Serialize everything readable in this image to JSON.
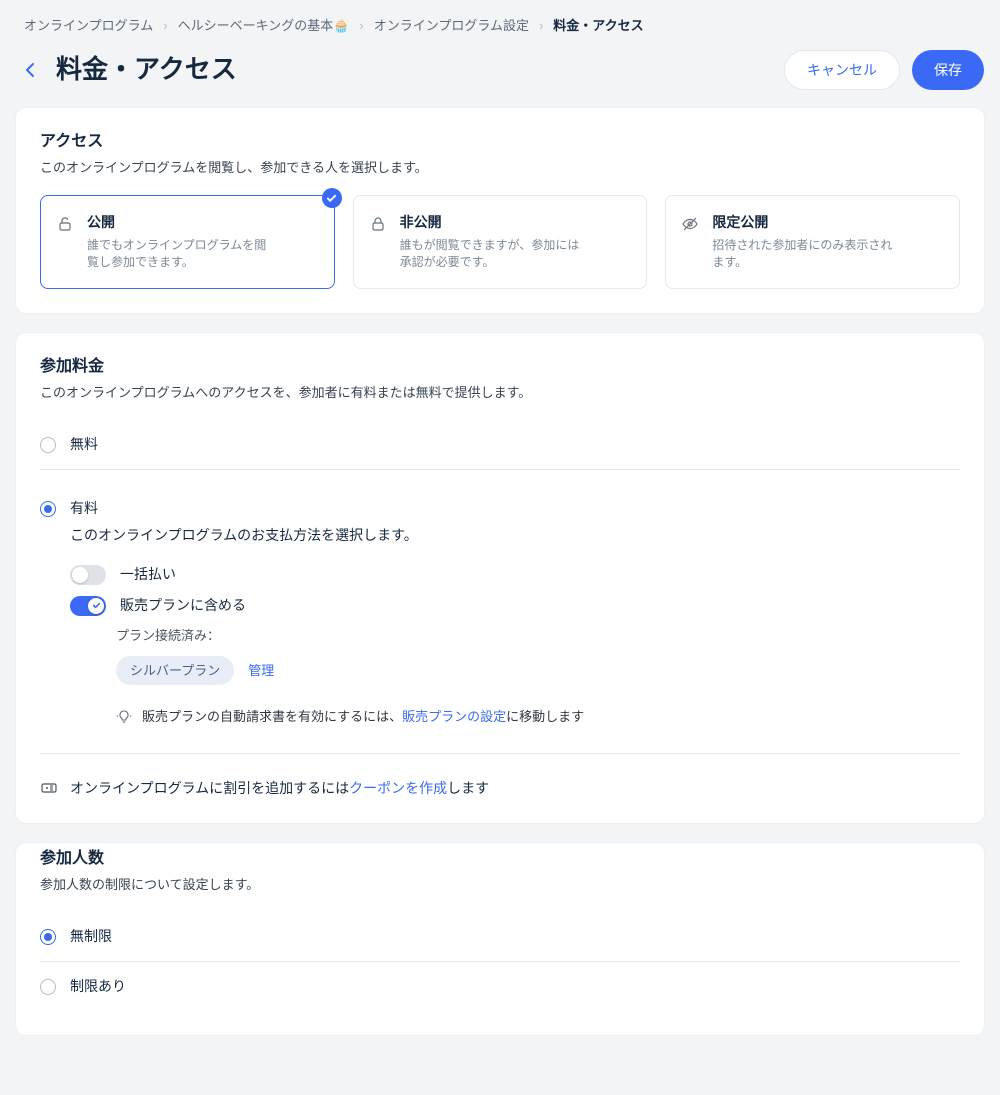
{
  "breadcrumb": {
    "items": [
      "オンラインプログラム",
      "ヘルシーベーキングの基本🧁",
      "オンラインプログラム設定",
      "料金・アクセス"
    ]
  },
  "header": {
    "title": "料金・アクセス",
    "cancel": "キャンセル",
    "save": "保存"
  },
  "access": {
    "title": "アクセス",
    "desc": "このオンラインプログラムを閲覧し、参加できる人を選択します。",
    "options": {
      "public": {
        "name": "公開",
        "desc": "誰でもオンラインプログラムを閲覧し参加できます。"
      },
      "private": {
        "name": "非公開",
        "desc": "誰もが閲覧できますが、参加には承認が必要です。"
      },
      "limited": {
        "name": "限定公開",
        "desc": "招待された参加者にのみ表示されます。"
      }
    }
  },
  "pricing": {
    "title": "参加料金",
    "desc": "このオンラインプログラムへのアクセスを、参加者に有料または無料で提供します。",
    "free": "無料",
    "paid": "有料",
    "paid_desc": "このオンラインプログラムのお支払方法を選択します。",
    "one_time": "一括払い",
    "include_plan": "販売プランに含める",
    "plan_connected": "プラン接続済み：",
    "plan_name": "シルバープラン",
    "manage": "管理",
    "hint_prefix": "販売プランの自動請求書を有効にするには、",
    "hint_link": "販売プランの設定",
    "hint_suffix": "に移動します",
    "coupon_prefix": "オンラインプログラムに割引を追加するには",
    "coupon_link": "クーポンを作成",
    "coupon_suffix": "します"
  },
  "participants": {
    "title": "参加人数",
    "desc": "参加人数の制限について設定します。",
    "unlimited": "無制限",
    "limited": "制限あり"
  }
}
